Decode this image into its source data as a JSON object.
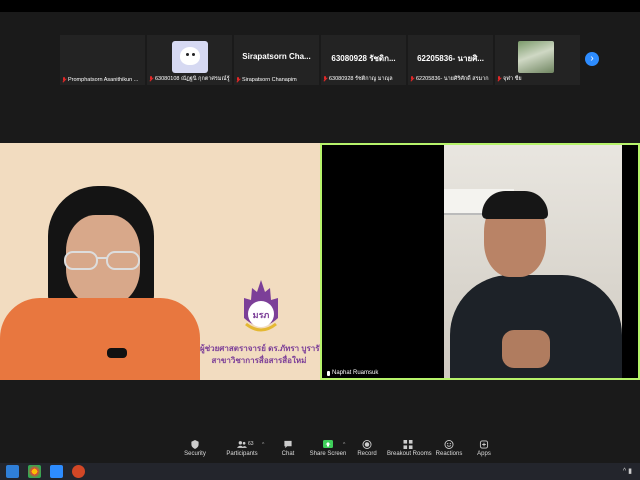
{
  "thumbnails": [
    {
      "caption": "Promphatsorn Asanithikun ...",
      "big": "",
      "kind": "name"
    },
    {
      "caption": "63080108 ณัฏฐนิ กุกตาศรมณ์รู้",
      "big": "",
      "kind": "avatar"
    },
    {
      "caption": "Sirapatsorn Chanapim",
      "big": "Sirapatsorn  Cha...",
      "kind": "name"
    },
    {
      "caption": "63080928 รัชติกาญ มาญุล",
      "big": "63080928 รัชดิก...",
      "kind": "name"
    },
    {
      "caption": "62205836- นายศิริศักดิ์ สรมาก",
      "big": "62205836- นายศิ...",
      "kind": "name"
    },
    {
      "caption": "จุฬา ชื่ย",
      "big": "",
      "kind": "photo"
    }
  ],
  "next_icon": "chevron-right-icon",
  "left_video": {
    "title_line1": "ผู้ช่วยศาสตราจารย์ ดร.ภัทรา บูรารักษ์",
    "title_line2": "สาขาวิชาการสื่อสารสื่อใหม่"
  },
  "right_video": {
    "name": "Naphat Ruamsuk"
  },
  "toolbar": {
    "security": "Security",
    "participants": "Participants",
    "participants_count": "63",
    "chat": "Chat",
    "share": "Share Screen",
    "record": "Record",
    "breakout": "Breakout Rooms",
    "reactions": "Reactions",
    "apps": "Apps"
  },
  "colors": {
    "active_speaker_border": "#b7f36b",
    "share_green": "#3ecf5a",
    "accent_blue": "#2d8cff"
  }
}
